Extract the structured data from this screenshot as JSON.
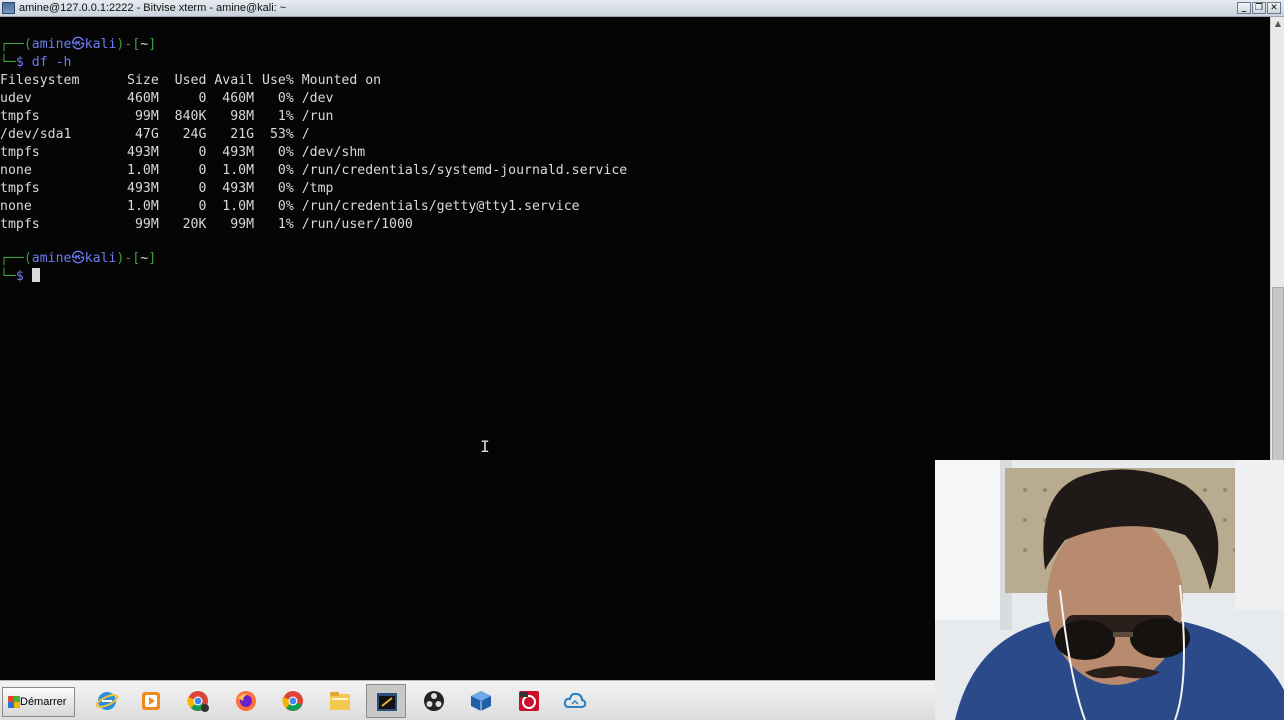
{
  "window": {
    "title": "amine@127.0.0.1:2222 - Bitvise xterm - amine@kali: ~",
    "minimize": "_",
    "restore": "❐",
    "close": "✕"
  },
  "terminal": {
    "prompt1": {
      "corner": "┌──(",
      "user": "amine",
      "at": "㉿",
      "host": "kali",
      "close": ")-[",
      "dir": "~",
      "end": "]"
    },
    "command1": {
      "corner": "└─",
      "dollar": "$",
      "cmd": " df -h"
    },
    "df_header": "Filesystem      Size  Used Avail Use% Mounted on",
    "df_rows": [
      "udev            460M     0  460M   0% /dev",
      "tmpfs            99M  840K   98M   1% /run",
      "/dev/sda1        47G   24G   21G  53% /",
      "tmpfs           493M     0  493M   0% /dev/shm",
      "none            1.0M     0  1.0M   0% /run/credentials/systemd-journald.service",
      "tmpfs           493M     0  493M   0% /tmp",
      "none            1.0M     0  1.0M   0% /run/credentials/getty@tty1.service",
      "tmpfs            99M   20K   99M   1% /run/user/1000"
    ],
    "prompt2": {
      "corner": "┌──(",
      "user": "amine",
      "at": "㉿",
      "host": "kali",
      "close": ")-[",
      "dir": "~",
      "end": "]"
    },
    "command2": {
      "corner": "└─",
      "dollar": "$",
      "cmd": " "
    }
  },
  "taskbar": {
    "start_label": "Démarrer",
    "apps": [
      {
        "name": "internet-explorer-icon"
      },
      {
        "name": "media-player-icon"
      },
      {
        "name": "chrome-profile-icon"
      },
      {
        "name": "firefox-icon"
      },
      {
        "name": "chrome-icon"
      },
      {
        "name": "file-explorer-icon"
      },
      {
        "name": "bitvise-xterm-icon",
        "active": true
      },
      {
        "name": "obs-icon"
      },
      {
        "name": "virtualbox-icon"
      },
      {
        "name": "debian-app-icon"
      },
      {
        "name": "cloud-sync-icon"
      }
    ]
  },
  "colors": {
    "prompt_frame": "#3f9e3f",
    "prompt_user": "#6c7bf2",
    "terminal_bg": "#050505",
    "terminal_fg": "#d9d9d9"
  }
}
